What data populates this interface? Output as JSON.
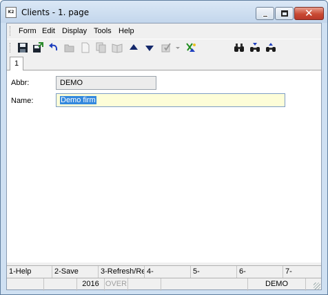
{
  "window": {
    "title": "Clients - 1. page",
    "app_icon_text": "K2",
    "close_glyph": "✕"
  },
  "menu": [
    "Form",
    "Edit",
    "Display",
    "Tools",
    "Help"
  ],
  "toolbar": {
    "icons": [
      "save-icon",
      "save-exit-icon",
      "undo-icon",
      "open-folder-icon",
      "new-document-icon",
      "copy-icon",
      "book-icon",
      "arrow-up-icon",
      "arrow-down-icon",
      "checklist-icon",
      "dropdown-arrow-icon",
      "confirm-icon",
      "binoculars-icon",
      "find-next-icon",
      "find-prev-icon"
    ]
  },
  "tabs": [
    {
      "label": "1"
    }
  ],
  "form": {
    "abbr_label": "Abbr:",
    "abbr_value": "DEMO",
    "name_label": "Name:",
    "name_value": "Demo firm"
  },
  "function_keys": [
    "1-Help",
    "2-Save",
    "3-Refresh/Re",
    "4-",
    "5-",
    "6-",
    "7-"
  ],
  "statusbar": [
    "",
    "",
    "2016",
    "OVER",
    "",
    "",
    "DEMO",
    ""
  ]
}
